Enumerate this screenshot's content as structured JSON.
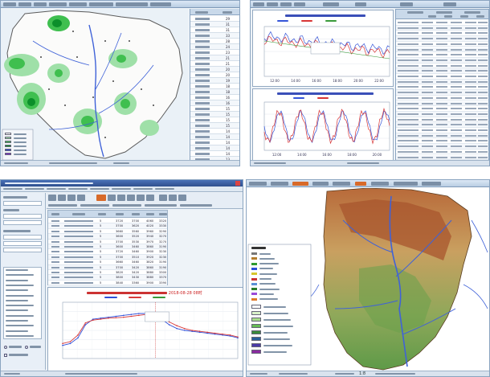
{
  "map1": {
    "ranking_rows": [
      "29",
      "31",
      "31",
      "33",
      "28",
      "24",
      "23",
      "21",
      "21",
      "20",
      "20",
      "19",
      "18",
      "18",
      "16",
      "16",
      "15",
      "15",
      "15",
      "15",
      "14",
      "14",
      "14",
      "14",
      "14",
      "13"
    ],
    "legend_colors": [
      "#ffffff",
      "#9fe0a8",
      "#3fbf4f",
      "#0b8f2a",
      "#2e44d8",
      "#7d2ad0"
    ]
  },
  "charts2": {
    "upper_times": [
      "12:00",
      "14:00",
      "16:00",
      "18:00",
      "20:00",
      "22:00"
    ],
    "lower_times": [
      "12:00",
      "14:00",
      "16:00",
      "18:00",
      "20:00"
    ],
    "series_colors": [
      "#3555d8",
      "#d83535"
    ],
    "table_rows": 26
  },
  "window3": {
    "table_values": [
      [
        "5",
        "3720",
        "3700",
        "4060",
        "3320"
      ],
      [
        "5",
        "3700",
        "3620",
        "4020",
        "3330"
      ],
      [
        "5",
        "3660",
        "3560",
        "3960",
        "3290"
      ],
      [
        "5",
        "3600",
        "3520",
        "3940",
        "3270"
      ],
      [
        "5",
        "3700",
        "3530",
        "3970",
        "3270"
      ],
      [
        "5",
        "3600",
        "3460",
        "3860",
        "3190"
      ],
      [
        "5",
        "3720",
        "3460",
        "3900",
        "3230"
      ],
      [
        "5",
        "3700",
        "3510",
        "3920",
        "3230"
      ],
      [
        "5",
        "3660",
        "3460",
        "3820",
        "3190"
      ],
      [
        "5",
        "3700",
        "3420",
        "3860",
        "3190"
      ],
      [
        "5",
        "3820",
        "3420",
        "3880",
        "3300"
      ],
      [
        "5",
        "3800",
        "3430",
        "3880",
        "3370"
      ],
      [
        "5",
        "3840",
        "3360",
        "3900",
        "3390"
      ]
    ],
    "forecast_title_date": "2018-08-28 08时",
    "chart_data": {
      "type": "line",
      "title": "",
      "series": [
        {
          "name": "",
          "color": "#2f4fd8",
          "values": [
            3540,
            3560,
            3620,
            3760,
            3820,
            3830,
            3840,
            3850,
            3860,
            3870,
            3880,
            3880,
            3860,
            3820,
            3760,
            3720,
            3700,
            3690,
            3680,
            3670,
            3660,
            3650,
            3640,
            3620
          ]
        },
        {
          "name": "",
          "color": "#d83a3a",
          "values": [
            3560,
            3580,
            3650,
            3780,
            3810,
            3820,
            3830,
            3835,
            3840,
            3850,
            3860,
            3870,
            3860,
            3830,
            3790,
            3750,
            3720,
            3700,
            3690,
            3680,
            3670,
            3660,
            3650,
            3630
          ]
        }
      ],
      "ylim": [
        3400,
        4000
      ]
    }
  },
  "map4": {
    "legend_colors": [
      "#777777",
      "#b57e2e",
      "#2f9a2f",
      "#2c4fd8",
      "#d6c62c",
      "#cc3333",
      "#5b8fd6",
      "#2a7a2a",
      "#9a4ad8",
      "#e07a2a"
    ],
    "status_text": "1:8"
  }
}
